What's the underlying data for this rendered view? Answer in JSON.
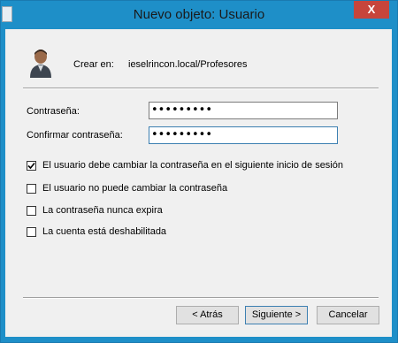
{
  "window": {
    "title": "Nuevo objeto: Usuario",
    "close_glyph": "X"
  },
  "header": {
    "create_in_label": "Crear en:",
    "create_in_path": "ieselrincon.local/Profesores",
    "icon": "user-icon"
  },
  "form": {
    "password_label": "Contraseña:",
    "password_value": "•••••••••",
    "confirm_label": "Confirmar contraseña:",
    "confirm_value": "•••••••••"
  },
  "options": [
    {
      "label": "El usuario debe cambiar la contraseña en el siguiente inicio de sesión",
      "checked": true
    },
    {
      "label": "El usuario no puede cambiar la contraseña",
      "checked": false
    },
    {
      "label": "La contraseña nunca expira",
      "checked": false
    },
    {
      "label": "La cuenta está deshabilitada",
      "checked": false
    }
  ],
  "buttons": {
    "back": "< Atrás",
    "next": "Siguiente >",
    "cancel": "Cancelar"
  }
}
